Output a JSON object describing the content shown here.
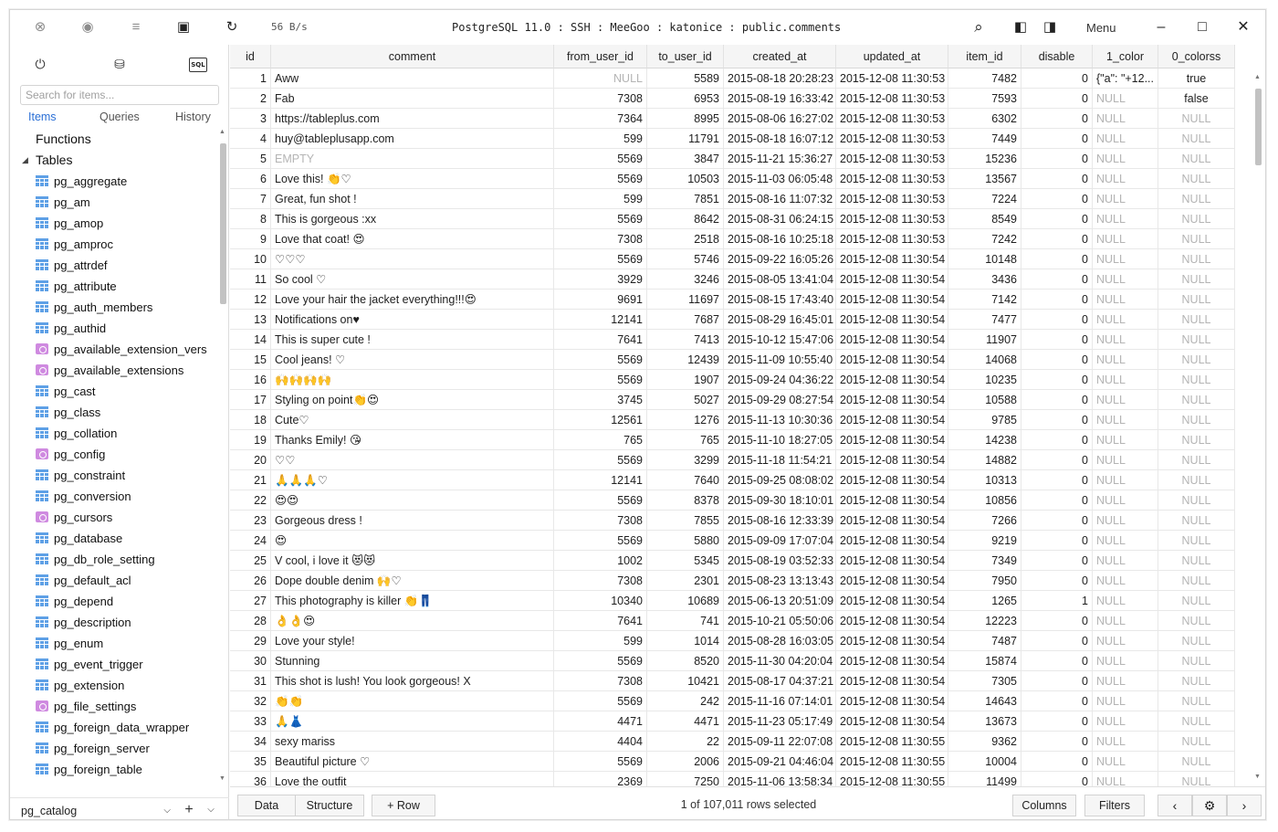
{
  "titlebar": {
    "speed": "56 B/s",
    "connection": "PostgreSQL 11.0 : SSH : MeeGoo : katonice : public.comments",
    "menu_label": "Menu"
  },
  "sidebar": {
    "search_placeholder": "Search for items...",
    "tabs": [
      "Items",
      "Queries",
      "History"
    ],
    "sections": {
      "functions": "Functions",
      "tables": "Tables"
    },
    "items": [
      {
        "name": "pg_aggregate",
        "kind": "table"
      },
      {
        "name": "pg_am",
        "kind": "table"
      },
      {
        "name": "pg_amop",
        "kind": "table"
      },
      {
        "name": "pg_amproc",
        "kind": "table"
      },
      {
        "name": "pg_attrdef",
        "kind": "table"
      },
      {
        "name": "pg_attribute",
        "kind": "table"
      },
      {
        "name": "pg_auth_members",
        "kind": "table"
      },
      {
        "name": "pg_authid",
        "kind": "table"
      },
      {
        "name": "pg_available_extension_vers",
        "kind": "view"
      },
      {
        "name": "pg_available_extensions",
        "kind": "view"
      },
      {
        "name": "pg_cast",
        "kind": "table"
      },
      {
        "name": "pg_class",
        "kind": "table"
      },
      {
        "name": "pg_collation",
        "kind": "table"
      },
      {
        "name": "pg_config",
        "kind": "view"
      },
      {
        "name": "pg_constraint",
        "kind": "table"
      },
      {
        "name": "pg_conversion",
        "kind": "table"
      },
      {
        "name": "pg_cursors",
        "kind": "view"
      },
      {
        "name": "pg_database",
        "kind": "table"
      },
      {
        "name": "pg_db_role_setting",
        "kind": "table"
      },
      {
        "name": "pg_default_acl",
        "kind": "table"
      },
      {
        "name": "pg_depend",
        "kind": "table"
      },
      {
        "name": "pg_description",
        "kind": "table"
      },
      {
        "name": "pg_enum",
        "kind": "table"
      },
      {
        "name": "pg_event_trigger",
        "kind": "table"
      },
      {
        "name": "pg_extension",
        "kind": "table"
      },
      {
        "name": "pg_file_settings",
        "kind": "view"
      },
      {
        "name": "pg_foreign_data_wrapper",
        "kind": "table"
      },
      {
        "name": "pg_foreign_server",
        "kind": "table"
      },
      {
        "name": "pg_foreign_table",
        "kind": "table"
      }
    ],
    "schema": "pg_catalog"
  },
  "grid": {
    "columns": [
      "id",
      "comment",
      "from_user_id",
      "to_user_id",
      "created_at",
      "updated_at",
      "item_id",
      "disable",
      "1_color",
      "0_colorss"
    ],
    "rows": [
      [
        "1",
        "Aww",
        "NULL",
        "5589",
        "2015-08-18 20:28:23",
        "2015-12-08 11:30:53",
        "7482",
        "0",
        "{\"a\": \"+12...",
        "true"
      ],
      [
        "2",
        "Fab",
        "7308",
        "6953",
        "2015-08-19 16:33:42",
        "2015-12-08 11:30:53",
        "7593",
        "0",
        "NULL",
        "false"
      ],
      [
        "3",
        "https://tableplus.com",
        "7364",
        "8995",
        "2015-08-06 16:27:02",
        "2015-12-08 11:30:53",
        "6302",
        "0",
        "NULL",
        "NULL"
      ],
      [
        "4",
        "huy@tableplusapp.com",
        "599",
        "11791",
        "2015-08-18 16:07:12",
        "2015-12-08 11:30:53",
        "7449",
        "0",
        "NULL",
        "NULL"
      ],
      [
        "5",
        "EMPTY",
        "5569",
        "3847",
        "2015-11-21 15:36:27",
        "2015-12-08 11:30:53",
        "15236",
        "0",
        "NULL",
        "NULL"
      ],
      [
        "6",
        "Love this! 👏♡",
        "5569",
        "10503",
        "2015-11-03 06:05:48",
        "2015-12-08 11:30:53",
        "13567",
        "0",
        "NULL",
        "NULL"
      ],
      [
        "7",
        "Great, fun shot !",
        "599",
        "7851",
        "2015-08-16 11:07:32",
        "2015-12-08 11:30:53",
        "7224",
        "0",
        "NULL",
        "NULL"
      ],
      [
        "8",
        "This is gorgeous :xx",
        "5569",
        "8642",
        "2015-08-31 06:24:15",
        "2015-12-08 11:30:53",
        "8549",
        "0",
        "NULL",
        "NULL"
      ],
      [
        "9",
        "Love that coat! 😍",
        "7308",
        "2518",
        "2015-08-16 10:25:18",
        "2015-12-08 11:30:53",
        "7242",
        "0",
        "NULL",
        "NULL"
      ],
      [
        "10",
        "♡♡♡",
        "5569",
        "5746",
        "2015-09-22 16:05:26",
        "2015-12-08 11:30:54",
        "10148",
        "0",
        "NULL",
        "NULL"
      ],
      [
        "11",
        "So cool ♡",
        "3929",
        "3246",
        "2015-08-05 13:41:04",
        "2015-12-08 11:30:54",
        "3436",
        "0",
        "NULL",
        "NULL"
      ],
      [
        "12",
        "Love your hair the jacket everything!!!😍",
        "9691",
        "11697",
        "2015-08-15 17:43:40",
        "2015-12-08 11:30:54",
        "7142",
        "0",
        "NULL",
        "NULL"
      ],
      [
        "13",
        "Notifications on♥",
        "12141",
        "7687",
        "2015-08-29 16:45:01",
        "2015-12-08 11:30:54",
        "7477",
        "0",
        "NULL",
        "NULL"
      ],
      [
        "14",
        "This is super cute  !",
        "7641",
        "7413",
        "2015-10-12 15:47:06",
        "2015-12-08 11:30:54",
        "11907",
        "0",
        "NULL",
        "NULL"
      ],
      [
        "15",
        "Cool jeans! ♡",
        "5569",
        "12439",
        "2015-11-09 10:55:40",
        "2015-12-08 11:30:54",
        "14068",
        "0",
        "NULL",
        "NULL"
      ],
      [
        "16",
        "🙌🙌🙌🙌",
        "5569",
        "1907",
        "2015-09-24 04:36:22",
        "2015-12-08 11:30:54",
        "10235",
        "0",
        "NULL",
        "NULL"
      ],
      [
        "17",
        "Styling on point👏😍",
        "3745",
        "5027",
        "2015-09-29 08:27:54",
        "2015-12-08 11:30:54",
        "10588",
        "0",
        "NULL",
        "NULL"
      ],
      [
        "18",
        "Cute♡",
        "12561",
        "1276",
        "2015-11-13 10:30:36",
        "2015-12-08 11:30:54",
        "9785",
        "0",
        "NULL",
        "NULL"
      ],
      [
        "19",
        "Thanks Emily! 😘",
        "765",
        "765",
        "2015-11-10 18:27:05",
        "2015-12-08 11:30:54",
        "14238",
        "0",
        "NULL",
        "NULL"
      ],
      [
        "20",
        "♡♡",
        "5569",
        "3299",
        "2015-11-18 11:54:21",
        "2015-12-08 11:30:54",
        "14882",
        "0",
        "NULL",
        "NULL"
      ],
      [
        "21",
        "🙏🙏🙏♡",
        "12141",
        "7640",
        "2015-09-25 08:08:02",
        "2015-12-08 11:30:54",
        "10313",
        "0",
        "NULL",
        "NULL"
      ],
      [
        "22",
        "😍😍",
        "5569",
        "8378",
        "2015-09-30 18:10:01",
        "2015-12-08 11:30:54",
        "10856",
        "0",
        "NULL",
        "NULL"
      ],
      [
        "23",
        "Gorgeous dress !",
        "7308",
        "7855",
        "2015-08-16 12:33:39",
        "2015-12-08 11:30:54",
        "7266",
        "0",
        "NULL",
        "NULL"
      ],
      [
        "24",
        "😍",
        "5569",
        "5880",
        "2015-09-09 17:07:04",
        "2015-12-08 11:30:54",
        "9219",
        "0",
        "NULL",
        "NULL"
      ],
      [
        "25",
        "V cool, i love it 😻😻",
        "1002",
        "5345",
        "2015-08-19 03:52:33",
        "2015-12-08 11:30:54",
        "7349",
        "0",
        "NULL",
        "NULL"
      ],
      [
        "26",
        "Dope double denim 🙌♡",
        "7308",
        "2301",
        "2015-08-23 13:13:43",
        "2015-12-08 11:30:54",
        "7950",
        "0",
        "NULL",
        "NULL"
      ],
      [
        "27",
        "This photography is killer 👏👖",
        "10340",
        "10689",
        "2015-06-13 20:51:09",
        "2015-12-08 11:30:54",
        "1265",
        "1",
        "NULL",
        "NULL"
      ],
      [
        "28",
        "👌👌😍",
        "7641",
        "741",
        "2015-10-21 05:50:06",
        "2015-12-08 11:30:54",
        "12223",
        "0",
        "NULL",
        "NULL"
      ],
      [
        "29",
        "Love your style!",
        "599",
        "1014",
        "2015-08-28 16:03:05",
        "2015-12-08 11:30:54",
        "7487",
        "0",
        "NULL",
        "NULL"
      ],
      [
        "30",
        "Stunning",
        "5569",
        "8520",
        "2015-11-30 04:20:04",
        "2015-12-08 11:30:54",
        "15874",
        "0",
        "NULL",
        "NULL"
      ],
      [
        "31",
        "This shot is lush! You look gorgeous! X",
        "7308",
        "10421",
        "2015-08-17 04:37:21",
        "2015-12-08 11:30:54",
        "7305",
        "0",
        "NULL",
        "NULL"
      ],
      [
        "32",
        "👏👏",
        "5569",
        "242",
        "2015-11-16 07:14:01",
        "2015-12-08 11:30:54",
        "14643",
        "0",
        "NULL",
        "NULL"
      ],
      [
        "33",
        "🙏👗",
        "4471",
        "4471",
        "2015-11-23 05:17:49",
        "2015-12-08 11:30:54",
        "13673",
        "0",
        "NULL",
        "NULL"
      ],
      [
        "34",
        "sexy mariss",
        "4404",
        "22",
        "2015-09-11 22:07:08",
        "2015-12-08 11:30:55",
        "9362",
        "0",
        "NULL",
        "NULL"
      ],
      [
        "35",
        "Beautiful picture ♡",
        "5569",
        "2006",
        "2015-09-21 04:46:04",
        "2015-12-08 11:30:55",
        "10004",
        "0",
        "NULL",
        "NULL"
      ],
      [
        "36",
        "Love the outfit",
        "2369",
        "7250",
        "2015-11-06 13:58:34",
        "2015-12-08 11:30:55",
        "11499",
        "0",
        "NULL",
        "NULL"
      ]
    ]
  },
  "bottombar": {
    "data_label": "Data",
    "structure_label": "Structure",
    "add_row_label": "+ Row",
    "status": "1 of 107,011 rows selected",
    "columns_label": "Columns",
    "filters_label": "Filters"
  },
  "colors": {
    "accent": "#2a6fd6",
    "null_text": "#b4b4b4",
    "table_icon": "#5ea0e6",
    "view_icon": "#cf8ae0"
  }
}
